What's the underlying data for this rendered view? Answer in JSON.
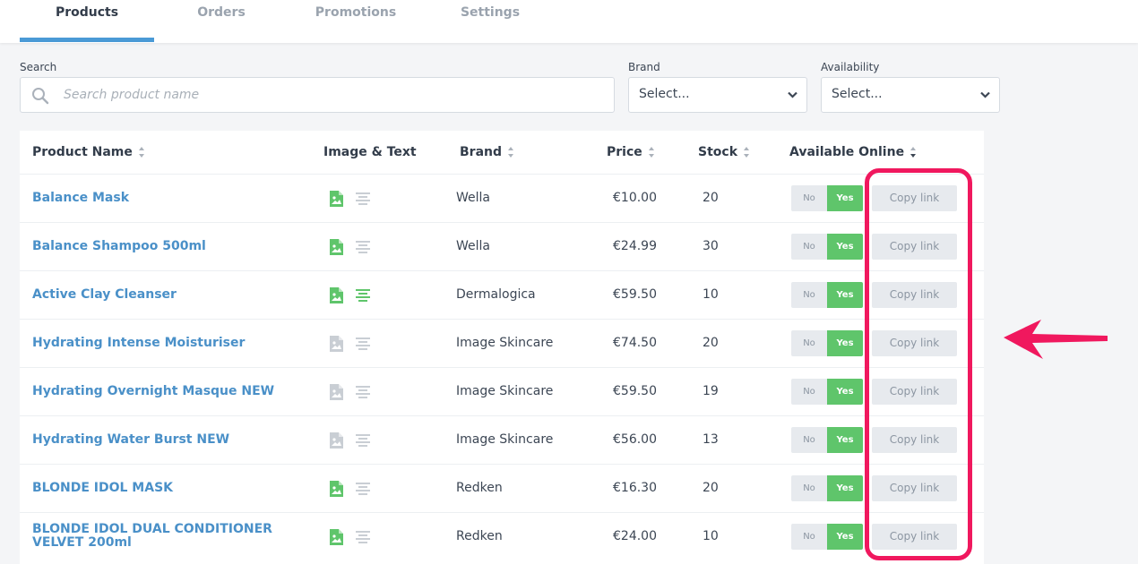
{
  "tabs": [
    {
      "label": "Products",
      "active": true
    },
    {
      "label": "Orders",
      "active": false
    },
    {
      "label": "Promotions",
      "active": false
    },
    {
      "label": "Settings",
      "active": false
    }
  ],
  "filters": {
    "search_label": "Search",
    "search_placeholder": "Search product name",
    "brand_label": "Brand",
    "brand_value": "Select...",
    "availability_label": "Availability",
    "availability_value": "Select..."
  },
  "table": {
    "headers": {
      "product_name": "Product Name",
      "image_text": "Image & Text",
      "brand": "Brand",
      "price": "Price",
      "stock": "Stock",
      "available_online": "Available Online"
    },
    "toggle_no": "No",
    "toggle_yes": "Yes",
    "copy_label": "Copy link",
    "rows": [
      {
        "name": "Balance Mask",
        "brand": "Wella",
        "price": "€10.00",
        "stock": "20",
        "image_set": true,
        "text_set": false
      },
      {
        "name": "Balance Shampoo 500ml",
        "brand": "Wella",
        "price": "€24.99",
        "stock": "30",
        "image_set": true,
        "text_set": false
      },
      {
        "name": "Active Clay Cleanser",
        "brand": "Dermalogica",
        "price": "€59.50",
        "stock": "10",
        "image_set": true,
        "text_set": true
      },
      {
        "name": "Hydrating Intense Moisturiser",
        "brand": "Image Skincare",
        "price": "€74.50",
        "stock": "20",
        "image_set": false,
        "text_set": false
      },
      {
        "name": "Hydrating Overnight Masque NEW",
        "brand": "Image Skincare",
        "price": "€59.50",
        "stock": "19",
        "image_set": false,
        "text_set": false
      },
      {
        "name": "Hydrating Water Burst NEW",
        "brand": "Image Skincare",
        "price": "€56.00",
        "stock": "13",
        "image_set": false,
        "text_set": false
      },
      {
        "name": "BLONDE IDOL MASK",
        "brand": "Redken",
        "price": "€16.30",
        "stock": "20",
        "image_set": true,
        "text_set": false
      },
      {
        "name": "BLONDE IDOL DUAL CONDITIONER VELVET 200ml",
        "brand": "Redken",
        "price": "€24.00",
        "stock": "10",
        "image_set": true,
        "text_set": false
      }
    ]
  },
  "colors": {
    "accent": "#4a9ad6",
    "link": "#4a90c8",
    "toggle_yes": "#5fc56b",
    "icon_active": "#5fc56b",
    "icon_inactive": "#c9ced4",
    "annotation": "#f0185e"
  },
  "icons": {
    "search": "search-icon",
    "dropdown": "chevron-down-icon",
    "sort": "sort-icon",
    "image": "image-icon",
    "text": "text-align-icon",
    "annotation_arrow": "arrow-left-icon"
  }
}
